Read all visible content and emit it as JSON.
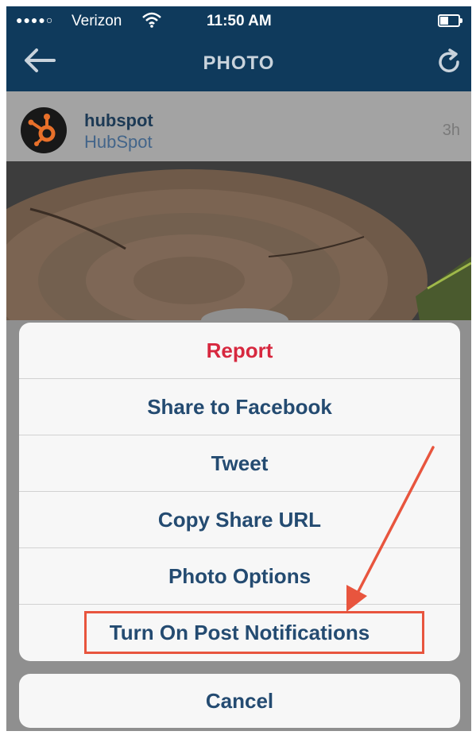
{
  "status_bar": {
    "signal": "●●●●○",
    "carrier": "Verizon",
    "time": "11:50 AM"
  },
  "nav": {
    "title": "PHOTO",
    "back_icon": "arrow-left-icon",
    "refresh_icon": "refresh-icon"
  },
  "post": {
    "username": "hubspot",
    "full_name": "HubSpot",
    "time_ago": "3h"
  },
  "action_sheet": {
    "items": [
      {
        "label": "Report",
        "style": "destructive"
      },
      {
        "label": "Share to Facebook",
        "style": "default"
      },
      {
        "label": "Tweet",
        "style": "default"
      },
      {
        "label": "Copy Share URL",
        "style": "default"
      },
      {
        "label": "Photo Options",
        "style": "default"
      },
      {
        "label": "Turn On Post Notifications",
        "style": "default"
      }
    ],
    "cancel_label": "Cancel"
  },
  "colors": {
    "nav_bar": "#0f3a5c",
    "action_text": "#244b71",
    "destructive_text": "#d7283f",
    "annotation": "#e8553e"
  }
}
